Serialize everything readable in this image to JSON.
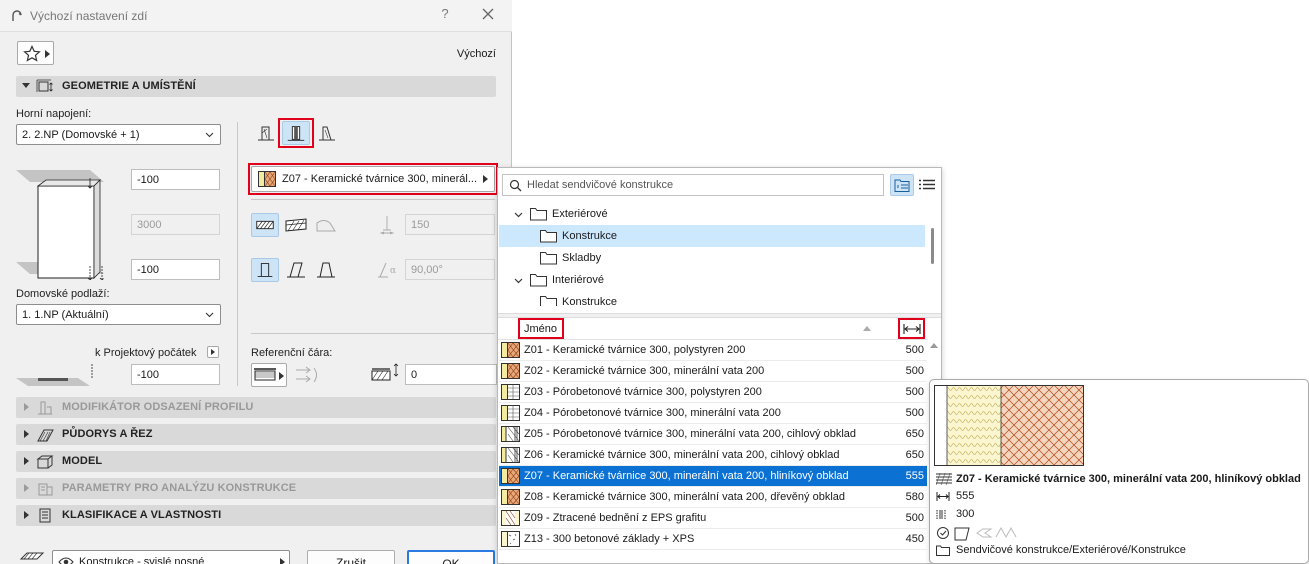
{
  "dialog": {
    "title": "Výchozí nastavení zdí",
    "help": "?",
    "default_label": "Výchozí"
  },
  "sections": {
    "geometry": "GEOMETRIE A UMÍSTĚNÍ",
    "profile": "MODIFIKÁTOR ODSAZENÍ PROFILU",
    "plan": "PŮDORYS A ŘEZ",
    "model": "MODEL",
    "analysis": "PARAMETRY PRO ANALÝZU KONSTRUKCE",
    "classification": "KLASIFIKACE A VLASTNOSTI"
  },
  "geometry": {
    "top_link_label": "Horní napojení:",
    "top_link_value": "2. 2.NP (Domovské + 1)",
    "top_offset": "-100",
    "height": "3000",
    "bottom_offset": "-100",
    "home_story_label": "Domovské podlaží:",
    "home_story_value": "1. 1.NP (Aktuální)",
    "project_zero_label": "k Projektový počátek",
    "project_zero_value": "-100",
    "composite_label": "Z07 - Keramické tvárnice 300, minerál...",
    "thickness": "150",
    "angle": "90,00°",
    "reference_line_label": "Referenční čára:",
    "reference_offset": "0"
  },
  "footer": {
    "layer_value": "Konstrukce - svislé nosné",
    "cancel_label": "Zrušit",
    "ok_label": "OK"
  },
  "popup": {
    "search_placeholder": "Hledat sendvičové konstrukce",
    "tree": [
      {
        "label": "Exteriérové"
      },
      {
        "label": "Konstrukce"
      },
      {
        "label": "Skladby"
      },
      {
        "label": "Interiérové"
      },
      {
        "label": "Konstrukce"
      }
    ],
    "column_name": "Jméno",
    "rows": [
      {
        "name": "Z01 - Keramické tvárnice 300, polystyren 200",
        "value": "500"
      },
      {
        "name": "Z02 - Keramické tvárnice 300, minerální vata 200",
        "value": "500"
      },
      {
        "name": "Z03 - Pórobetonové tvárnice 300, polystyren 200",
        "value": "500"
      },
      {
        "name": "Z04 - Pórobetonové tvárnice 300, minerální vata 200",
        "value": "500"
      },
      {
        "name": "Z05 - Pórobetonové tvárnice 300, minerální vata 200, cihlový obklad",
        "value": "650"
      },
      {
        "name": "Z06 - Keramické tvárnice 300, minerální vata 200, cihlový obklad",
        "value": "650"
      },
      {
        "name": "Z07 - Keramické tvárnice 300, minerální vata 200, hliníkový obklad",
        "value": "555"
      },
      {
        "name": "Z08 - Keramické tvárnice 300, minerální vata 200, dřevěný obklad",
        "value": "580"
      },
      {
        "name": "Z09 - Ztracené bednění z EPS grafitu",
        "value": "500"
      },
      {
        "name": "Z13 - 300 betonové základy + XPS",
        "value": "450"
      }
    ]
  },
  "preview": {
    "name": "Z07 - Keramické tvárnice 300, minerální vata 200, hliníkový obklad",
    "total_thickness": "555",
    "core_thickness": "300",
    "path": "Sendvičové konstrukce/Exteriérové/Konstrukce"
  },
  "colors": {
    "selection": "#0b72d4",
    "highlight": "#e0001b",
    "tree_selection": "#cce8ff",
    "insulation": "#f3eba0",
    "brick": "#c8652c"
  }
}
